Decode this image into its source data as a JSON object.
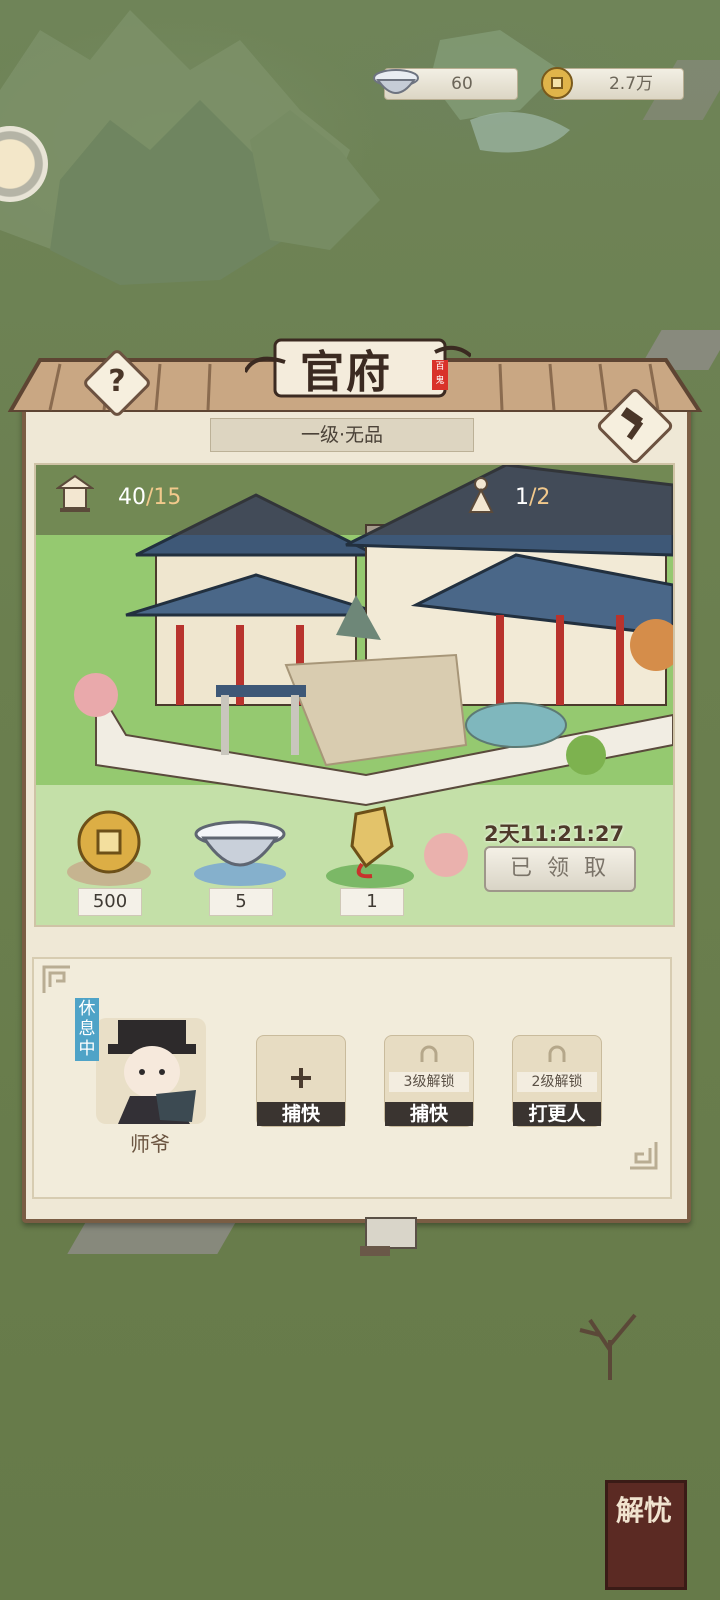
{
  "resources": {
    "silver": {
      "icon": "silver-ingot-icon",
      "value": "60"
    },
    "coins": {
      "icon": "copper-coin-icon",
      "value": "2.7万"
    }
  },
  "panel": {
    "title": "官府",
    "seal_text": "百鬼",
    "level": "一级·无品",
    "stats": {
      "building_value": "40",
      "building_max": "/15",
      "staff_value": "1",
      "staff_max": "/2"
    },
    "rewards": [
      {
        "icon": "copper-coin-icon",
        "amount": "500"
      },
      {
        "icon": "silver-ingot-icon",
        "amount": "5"
      },
      {
        "icon": "jade-token-icon",
        "amount": "1"
      }
    ],
    "timer": "2天11:21:27",
    "claimed_label": "已 领 取",
    "staff": {
      "status": "休息中",
      "name": "师爷",
      "slots": [
        {
          "role": "捕快",
          "lock": "",
          "icon": "plus-icon"
        },
        {
          "role": "捕快",
          "lock": "3级解锁",
          "icon": "lock-icon"
        },
        {
          "role": "打更人",
          "lock": "2级解锁",
          "icon": "lock-icon"
        }
      ]
    }
  },
  "corner_button": "解忧",
  "colors": {
    "frame": "#7a5d44",
    "panel_bg": "#efe8d6",
    "badge": "#4fa3c7"
  }
}
